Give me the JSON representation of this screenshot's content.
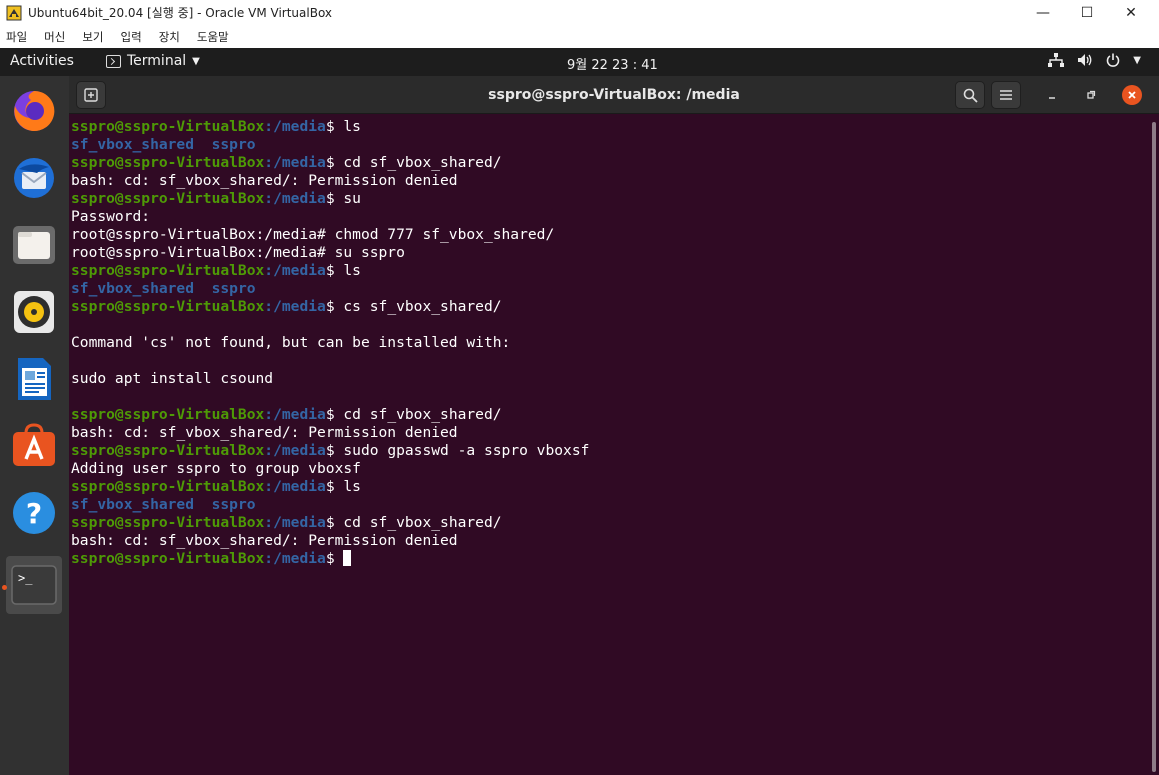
{
  "host": {
    "title": "Ubuntu64bit_20.04 [실행 중] - Oracle VM VirtualBox",
    "menu": [
      "파일",
      "머신",
      "보기",
      "입력",
      "장치",
      "도움말"
    ],
    "window_buttons": {
      "minimize": "—",
      "maximize": "☐",
      "close": "✕"
    }
  },
  "topbar": {
    "activities": "Activities",
    "app_menu": "Terminal",
    "clock": "9월 22  23 : 41"
  },
  "dock": {
    "items": [
      "firefox-icon",
      "thunderbird-icon",
      "files-icon",
      "rhythmbox-icon",
      "libreoffice-writer-icon",
      "ubuntu-software-icon",
      "help-icon",
      "terminal-icon"
    ]
  },
  "terminal": {
    "title": "sspro@sspro-VirtualBox: /media",
    "prompt_user": "sspro@sspro-VirtualBox",
    "prompt_path": ":/media",
    "prompt_end": "$ ",
    "lines": [
      {
        "type": "prompt",
        "cmd": "ls"
      },
      {
        "type": "dirs",
        "items": [
          "sf_vbox_shared",
          "sspro"
        ]
      },
      {
        "type": "prompt",
        "cmd": "cd sf_vbox_shared/"
      },
      {
        "type": "out",
        "text": "bash: cd: sf_vbox_shared/: Permission denied"
      },
      {
        "type": "prompt",
        "cmd": "su"
      },
      {
        "type": "out",
        "text": "Password:"
      },
      {
        "type": "out",
        "text": "root@sspro-VirtualBox:/media# chmod 777 sf_vbox_shared/"
      },
      {
        "type": "out",
        "text": "root@sspro-VirtualBox:/media# su sspro"
      },
      {
        "type": "prompt",
        "cmd": "ls"
      },
      {
        "type": "dirs",
        "items": [
          "sf_vbox_shared",
          "sspro"
        ]
      },
      {
        "type": "prompt",
        "cmd": "cs sf_vbox_shared/"
      },
      {
        "type": "out",
        "text": ""
      },
      {
        "type": "out",
        "text": "Command 'cs' not found, but can be installed with:"
      },
      {
        "type": "out",
        "text": ""
      },
      {
        "type": "out",
        "text": "sudo apt install csound"
      },
      {
        "type": "out",
        "text": ""
      },
      {
        "type": "prompt",
        "cmd": "cd sf_vbox_shared/"
      },
      {
        "type": "out",
        "text": "bash: cd: sf_vbox_shared/: Permission denied"
      },
      {
        "type": "prompt",
        "cmd": "sudo gpasswd -a sspro vboxsf"
      },
      {
        "type": "out",
        "text": "Adding user sspro to group vboxsf"
      },
      {
        "type": "prompt",
        "cmd": "ls"
      },
      {
        "type": "dirs",
        "items": [
          "sf_vbox_shared",
          "sspro"
        ]
      },
      {
        "type": "prompt",
        "cmd": "cd sf_vbox_shared/"
      },
      {
        "type": "out",
        "text": "bash: cd: sf_vbox_shared/: Permission denied"
      },
      {
        "type": "prompt",
        "cmd": "",
        "cursor": true
      }
    ]
  },
  "colors": {
    "terminal_bg": "#300a24",
    "prompt_user": "#4e9a06",
    "prompt_path": "#3465a4",
    "accent": "#e95420"
  }
}
